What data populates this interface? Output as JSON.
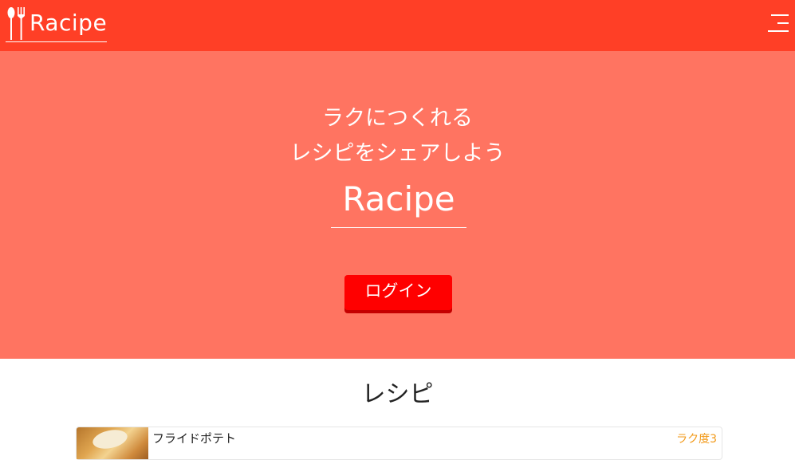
{
  "header": {
    "brand": "Racipe",
    "brand_icon": "fork-spoon-icon",
    "menu_icon": "hamburger-menu-icon",
    "background_color": "#ff3f26"
  },
  "hero": {
    "tagline_line1": "ラクにつくれる",
    "tagline_line2": "レシピをシェアしよう",
    "title": "Racipe",
    "login_label": "ログイン",
    "background_color": "#ff7461",
    "button_color": "#ff0000"
  },
  "recipes": {
    "section_title": "レシピ",
    "items": [
      {
        "name": "フライドポテト",
        "level": "ラク度3",
        "thumbnail": "fried-potato-photo"
      }
    ],
    "level_color": "#f29a1a"
  }
}
